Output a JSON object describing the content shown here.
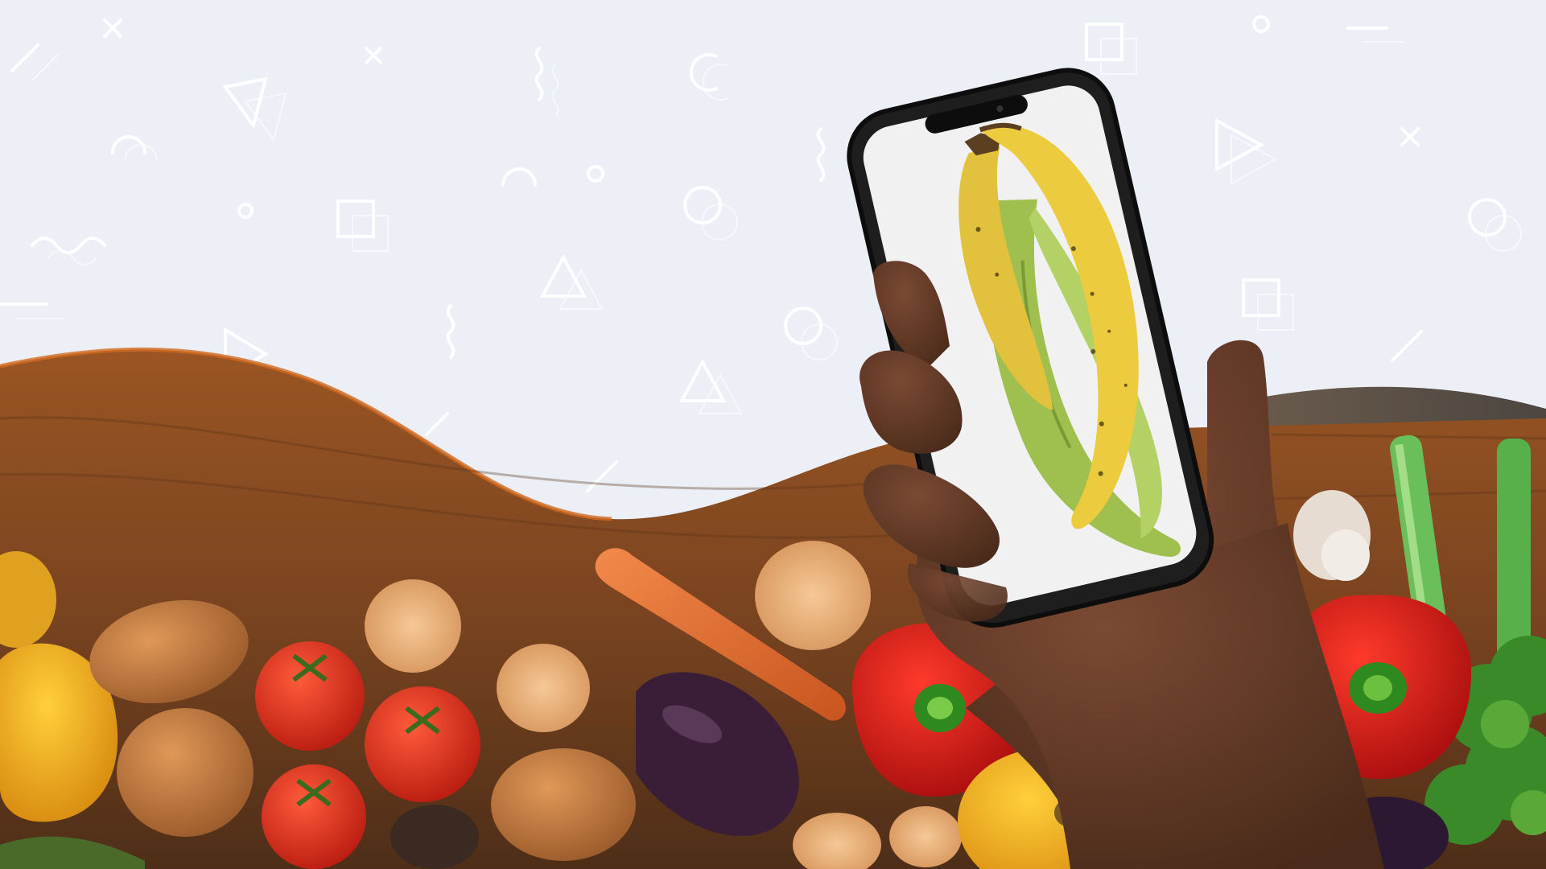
{
  "scene": {
    "background_color": "#eceff6",
    "doodle_color": "#ffffff",
    "board_color": "#8a4b1f",
    "board_dark": "#4a2a14",
    "vegetables": [
      "yellow-bell-pepper",
      "potato",
      "tomato",
      "yam-slice",
      "carrot",
      "eggplant",
      "red-bell-pepper",
      "leek",
      "parsley",
      "garlic"
    ],
    "phone_color": "#111111",
    "screen_background": "#f1f1f1",
    "plantain_yellow": "#e9c93d",
    "plantain_green": "#a9c75a",
    "hand_color": "#5a3423"
  }
}
